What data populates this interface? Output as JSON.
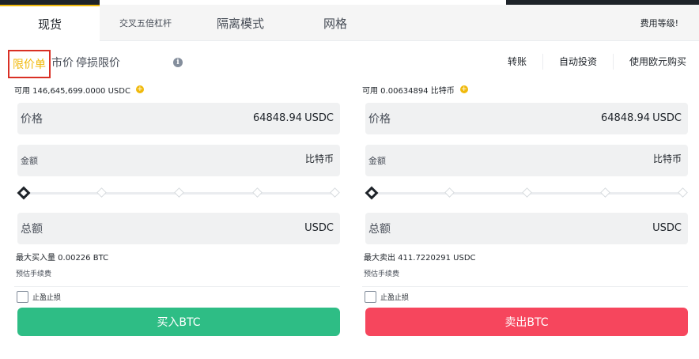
{
  "tabs": [
    {
      "label": "现货",
      "active": true
    },
    {
      "label": "交叉五倍杠杆",
      "active": false
    },
    {
      "label": "隔离模式",
      "active": false
    },
    {
      "label": "网格",
      "active": false
    }
  ],
  "fee_link": "费用等级!",
  "order_types": {
    "limit": "限价单",
    "market": "市价",
    "stop_limit": "停损限价"
  },
  "right_links": [
    "转账",
    "自动投资",
    "使用欧元购买"
  ],
  "buy": {
    "available": "可用 146,645,699.0000 USDC",
    "price_label": "价格",
    "price_value": "64848.94",
    "price_unit": "USDC",
    "amount_label": "金额",
    "amount_unit": "比特币",
    "total_label": "总额",
    "total_unit": "USDC",
    "max_line": "最大买入量 0.00226 BTC",
    "fee_line": "预估手续费",
    "tpsl_label": "止盈止损",
    "button": "买入BTC",
    "slider_percent": 0
  },
  "sell": {
    "available": "可用 0.00634894 比特币",
    "price_label": "价格",
    "price_value": "64848.94",
    "price_unit": "USDC",
    "amount_label": "金额",
    "amount_unit": "比特币",
    "total_label": "总额",
    "total_unit": "USDC",
    "max_line": "最大卖出 411.7220291 USDC",
    "fee_line": "预估手续费",
    "tpsl_label": "止盈止损",
    "button": "卖出BTC",
    "slider_percent": 0
  },
  "icons": {
    "info": "info-icon",
    "add": "plus-circle-icon"
  },
  "colors": {
    "accent": "#f0b90b",
    "buy": "#2ebd85",
    "sell": "#f6465d",
    "highlight_box": "#d93025"
  }
}
